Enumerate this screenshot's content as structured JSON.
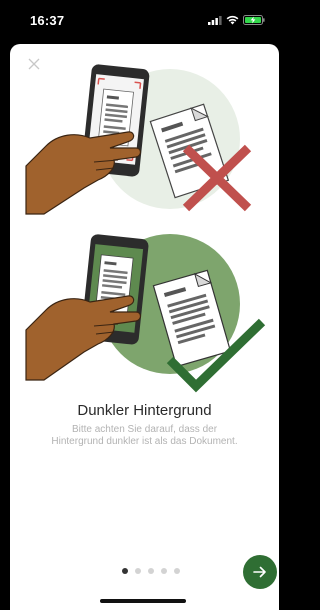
{
  "status": {
    "time": "16:37",
    "icons": [
      "cellular-signal-icon",
      "wifi-icon",
      "battery-charging-icon"
    ],
    "battery_color": "#32d74b"
  },
  "onboarding": {
    "close_icon": "close-icon",
    "title": "Dunkler Hintergrund",
    "description": "Bitte achten Sie darauf, dass der Hintergrund dunkler ist als das Dokument.",
    "illustrations": [
      {
        "name": "incorrect-example",
        "status_icon": "cross-icon",
        "status_color": "#c0504d"
      },
      {
        "name": "correct-example",
        "status_icon": "check-icon",
        "status_color": "#2f6e33"
      }
    ]
  },
  "pager": {
    "total": 5,
    "current": 1
  },
  "next_button": {
    "icon": "arrow-right-icon",
    "color": "#2f6e33"
  }
}
